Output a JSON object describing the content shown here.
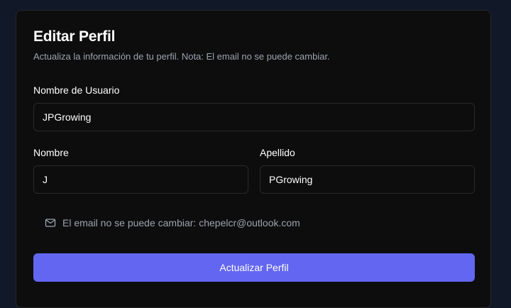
{
  "form": {
    "title": "Editar Perfil",
    "subtitle": "Actualiza la información de tu perfil. Nota: El email no se puede cambiar.",
    "username": {
      "label": "Nombre de Usuario",
      "value": "JPGrowing"
    },
    "first_name": {
      "label": "Nombre",
      "value": "J"
    },
    "last_name": {
      "label": "Apellido",
      "value": "PGrowing"
    },
    "email_note": {
      "icon": "mail-icon",
      "text": "El email no se puede cambiar: chepelcr@outlook.com"
    },
    "submit_label": "Actualizar Perfil"
  },
  "colors": {
    "page_background": "#111827",
    "card_background": "#0d0d0d",
    "accent": "#6366f1",
    "muted_text": "#9ca3af"
  }
}
